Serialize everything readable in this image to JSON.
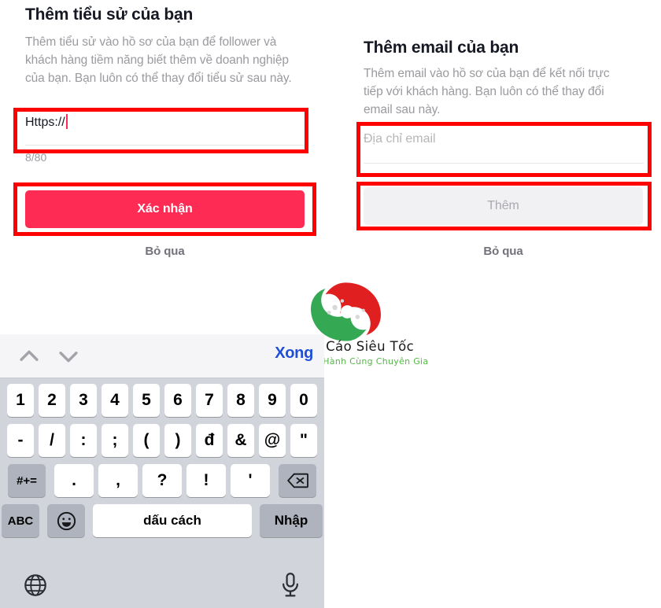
{
  "left_panel": {
    "title": "Thêm tiểu sử của bạn",
    "description": "Thêm tiểu sử vào hồ sơ của bạn để follower và khách hàng tiềm năng biết thêm về doanh nghiệp của bạn. Bạn luôn có thể thay đổi tiểu sử sau này.",
    "input": {
      "value": "Https://",
      "placeholder": ""
    },
    "counter": "8/80",
    "primary_button": "Xác nhận",
    "skip_label": "Bỏ qua",
    "accent_color": "#fe2c55",
    "caret_color": "#fe2c55"
  },
  "right_panel": {
    "title": "Thêm email của bạn",
    "description": "Thêm email vào hồ sơ của bạn để kết nối trực tiếp với khách hàng. Bạn luôn có thể thay đổi email sau này.",
    "input": {
      "value": "",
      "placeholder": "Địa chỉ email"
    },
    "primary_button": "Thêm",
    "skip_label": "Bỏ qua",
    "button_state": "disabled",
    "disabled_color": "#f1f1f3"
  },
  "annotations": {
    "color": "#ff0000",
    "boxes": [
      {
        "name": "bio-input-highlight"
      },
      {
        "name": "confirm-button-highlight"
      },
      {
        "name": "email-input-highlight"
      },
      {
        "name": "add-button-highlight"
      }
    ]
  },
  "keyboard": {
    "accessory": {
      "prev_icon": "chevron-up-icon",
      "next_icon": "chevron-down-icon",
      "done_label": "Xong",
      "done_color": "#1f4fd8"
    },
    "rows": {
      "numbers": [
        "1",
        "2",
        "3",
        "4",
        "5",
        "6",
        "7",
        "8",
        "9",
        "0"
      ],
      "symbols": [
        "-",
        "/",
        ":",
        ";",
        "(",
        ")",
        "đ",
        "&",
        "@",
        "\""
      ],
      "punctuation": [
        ".",
        ",",
        "?",
        "!",
        "'"
      ],
      "shift_symbols_label": "#+=",
      "backspace_icon": "backspace-icon",
      "abc_label": "ABC",
      "emoji_icon": "emoji-smiley-icon",
      "space_label": "dấu cách",
      "enter_label": "Nhập"
    },
    "bottom_bar": {
      "globe_icon": "globe-icon",
      "mic_icon": "microphone-icon"
    },
    "background_color": "#d1d4da",
    "key_color": "#ffffff",
    "modifier_key_color": "#aeb3bd"
  },
  "watermark": {
    "brand": "Quảng Cáo Siêu Tốc",
    "tagline": "Đồng Hành Cùng Chuyên Gia",
    "brand_color": "#1a1a1a",
    "tagline_color": "#56b64a",
    "logo_colors": {
      "green": "#34a853",
      "red": "#e02020"
    }
  }
}
